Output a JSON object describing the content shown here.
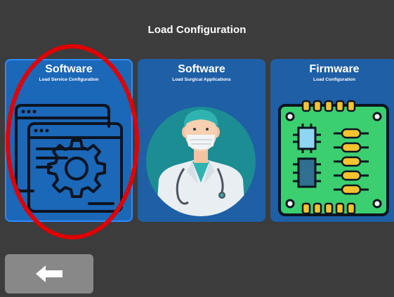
{
  "header": {
    "title": "Load Configuration"
  },
  "cards": [
    {
      "title": "Software",
      "subtitle": "Load Service Configuration",
      "icon": "settings-windows-icon",
      "selected": true
    },
    {
      "title": "Software",
      "subtitle": "Load Surgical Applications",
      "icon": "surgeon-icon",
      "selected": false
    },
    {
      "title": "Firmware",
      "subtitle": "Load Configuration",
      "icon": "circuit-board-icon",
      "selected": false
    }
  ],
  "back_button": {
    "icon": "arrow-left-icon"
  },
  "colors": {
    "background": "#3c3c3c",
    "card": "#1e5fa6",
    "highlight_ring": "#e00000",
    "back_button": "#888888"
  }
}
